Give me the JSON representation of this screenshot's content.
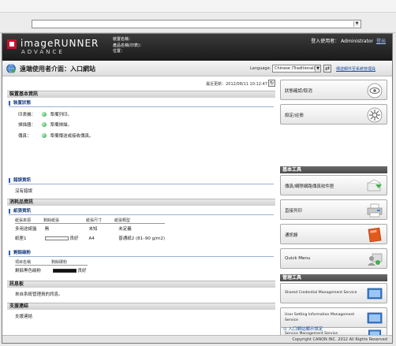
{
  "browser": {
    "address": ""
  },
  "header": {
    "logo_line1": "imageRUNNER",
    "logo_line2": "ADVANCE",
    "device_name_label": "裝置名稱：",
    "product_name_label": "產品名稱(印表)：",
    "location_label": "位置：",
    "login_label": "登入使用者：",
    "login_user": "Administrator",
    "logout": "登出"
  },
  "titlebar": {
    "title": "遠端使用者介面：入口網站",
    "language_label": "Language:",
    "language_value": "Chinese (Traditional)",
    "apply_glyph": "⇄",
    "send_mail_link": "傳送郵件至系統管理員"
  },
  "main": {
    "last_update": "最近更新：2012/08/11 10:12:47",
    "refresh_glyph": "↻",
    "device_basic": {
      "heading": "裝置基本資訊",
      "status_heading": "裝置狀態",
      "rows": [
        {
          "label": "印表機：",
          "value": "準備列印。"
        },
        {
          "label": "掃描器：",
          "value": "準備掃描。"
        },
        {
          "label": "傳真：",
          "value": "準備傳送或接收傳真。"
        }
      ],
      "error_heading": "錯誤資訊",
      "error_value": "沒有錯誤"
    },
    "consumables": {
      "heading": "消耗品資訊",
      "paper_heading": "紙張資訊",
      "paper_cols": [
        "紙張來源",
        "剩餘紙張",
        "紙張尺寸",
        "紙張類型"
      ],
      "paper_rows": [
        {
          "source": "多用途紙盤",
          "remain": "無",
          "size": "未知",
          "type": "未定義"
        },
        {
          "source": "紙匣1",
          "remain": "良好",
          "size": "A4",
          "type": "普通紙2 (81–90 g/m2)"
        }
      ],
      "toner_heading": "剩餘碳粉",
      "toner_cols": [
        "項目名稱",
        "剩餘碳粉"
      ],
      "toner_rows": [
        {
          "name": "剩餘黑色碳粉",
          "remain": "良好"
        }
      ]
    },
    "message_board": {
      "heading": "訊息板",
      "text": "來自系統管理員的訊息。"
    },
    "support": {
      "heading": "支援連結",
      "text": "支援連結"
    }
  },
  "sidebar": {
    "top_buttons": [
      {
        "label": "狀態確認/取消",
        "icon": "status-eye-icon"
      },
      {
        "label": "設定/註冊",
        "icon": "settings-gear-icon"
      }
    ],
    "basic_tools_heading": "基本工具",
    "basic_tools": [
      {
        "label": "傳真/網際網路傳真收件匣",
        "icon": "fax-inbox-icon"
      },
      {
        "label": "直接列印",
        "icon": "printer-icon"
      },
      {
        "label": "通訊錄",
        "icon": "address-book-icon"
      },
      {
        "label": "Quick Menu",
        "icon": "quick-menu-icon"
      }
    ],
    "mgmt_tools_heading": "管理工具",
    "mgmt_tools": [
      {
        "label": "Shared Credential Management Service",
        "icon": "monitor-icon"
      },
      {
        "label": "User Setting Information Management Service",
        "icon": "monitor-icon"
      },
      {
        "label": "Service Management Service",
        "icon": "monitor-icon"
      }
    ],
    "portal_link": "入口網站顯示設定"
  },
  "footer": {
    "copyright": "Copyright CANON INC. 2012 All Rights Reserved"
  },
  "colors": {
    "header_bg": "#1a1a1a",
    "link": "#1a4fa0",
    "status_ok": "#2aa24a"
  }
}
